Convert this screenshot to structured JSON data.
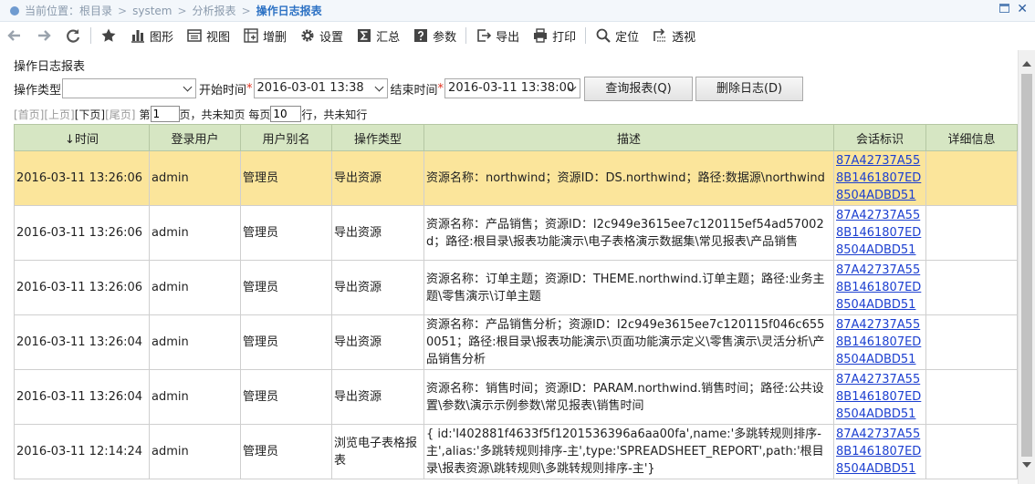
{
  "breadcrumb": {
    "prefix": "当前位置：",
    "items": [
      "根目录",
      "system",
      "分析报表"
    ],
    "current": "操作日志报表",
    "separator": ">"
  },
  "toolbar": {
    "buttons": [
      {
        "name": "back-button",
        "icon": "arrow-left-icon",
        "label": ""
      },
      {
        "name": "forward-button",
        "icon": "arrow-right-icon",
        "label": ""
      },
      {
        "name": "refresh-button",
        "icon": "refresh-icon",
        "label": ""
      },
      {
        "name": "favorite-button",
        "icon": "star-icon",
        "label": ""
      },
      {
        "name": "chart-button",
        "icon": "bar-chart-icon",
        "label": "图形"
      },
      {
        "name": "view-button",
        "icon": "view-icon",
        "label": "视图"
      },
      {
        "name": "add-column-button",
        "icon": "add-column-icon",
        "label": "增删"
      },
      {
        "name": "settings-button",
        "icon": "gear-icon",
        "label": "设置"
      },
      {
        "name": "summary-button",
        "icon": "sigma-icon",
        "label": "汇总"
      },
      {
        "name": "param-button",
        "icon": "question-icon",
        "label": "参数"
      },
      {
        "name": "export-button",
        "icon": "export-icon",
        "label": "导出"
      },
      {
        "name": "print-button",
        "icon": "printer-icon",
        "label": "打印"
      },
      {
        "name": "locate-button",
        "icon": "search-icon",
        "label": "定位"
      },
      {
        "name": "pivot-button",
        "icon": "pivot-icon",
        "label": "透视"
      }
    ]
  },
  "report_title": "操作日志报表",
  "filters": {
    "op_type_label": "操作类型",
    "op_type_value": "",
    "start_label": "开始时间",
    "start_value": "2016-03-01 13:38",
    "end_label": "结束时间",
    "end_value": "2016-03-11 13:38:00",
    "required_mark": "*",
    "query_button": "查询报表(Q)",
    "delete_button": "删除日志(D)"
  },
  "pager": {
    "first": "[首页]",
    "prev": "[上页]",
    "next": "[下页]",
    "last": "[尾页]",
    "page_prefix": "第",
    "page_value": "1",
    "page_suffix": "页，共未知页 每页",
    "size_value": "10",
    "size_suffix": "行，共未知行"
  },
  "table": {
    "columns": [
      "↓时间",
      "登录用户",
      "用户别名",
      "操作类型",
      "描述",
      "会话标识",
      "详细信息"
    ],
    "rows": [
      {
        "time": "2016-03-11 13:26:06",
        "user": "admin",
        "alias": "管理员",
        "op": "导出资源",
        "desc": "资源名称：northwind；资源ID：DS.northwind；路径:数据源\\northwind",
        "session": [
          "87A42737A55",
          "8B1461807ED",
          "8504ADBD51"
        ],
        "detail": ""
      },
      {
        "time": "2016-03-11 13:26:06",
        "user": "admin",
        "alias": "管理员",
        "op": "导出资源",
        "desc": "资源名称：产品销售；资源ID：I2c949e3615ee7c120115ef54ad57002d；路径:根目录\\报表功能演示\\电子表格演示数据集\\常见报表\\产品销售",
        "session": [
          "87A42737A55",
          "8B1461807ED",
          "8504ADBD51"
        ],
        "detail": ""
      },
      {
        "time": "2016-03-11 13:26:06",
        "user": "admin",
        "alias": "管理员",
        "op": "导出资源",
        "desc": "资源名称：订单主题；资源ID：THEME.northwind.订单主题；路径:业务主题\\零售演示\\订单主题",
        "session": [
          "87A42737A55",
          "8B1461807ED",
          "8504ADBD51"
        ],
        "detail": ""
      },
      {
        "time": "2016-03-11 13:26:04",
        "user": "admin",
        "alias": "管理员",
        "op": "导出资源",
        "desc": "资源名称：产品销售分析；资源ID：I2c949e3615ee7c120115f046c6550051；路径:根目录\\报表功能演示\\页面功能演示定义\\零售演示\\灵活分析\\产品销售分析",
        "session": [
          "87A42737A55",
          "8B1461807ED",
          "8504ADBD51"
        ],
        "detail": ""
      },
      {
        "time": "2016-03-11 13:26:04",
        "user": "admin",
        "alias": "管理员",
        "op": "导出资源",
        "desc": "资源名称：销售时间；资源ID：PARAM.northwind.销售时间；路径:公共设置\\参数\\演示示例参数\\常见报表\\销售时间",
        "session": [
          "87A42737A55",
          "8B1461807ED",
          "8504ADBD51"
        ],
        "detail": ""
      },
      {
        "time": "2016-03-11 12:14:24",
        "user": "admin",
        "alias": "管理员",
        "op": "浏览电子表格报表",
        "desc": "{ id:'I402881f4633f5f1201536396a6aa00fa',name:'多跳转规则排序-主',alias:'多跳转规则排序-主',type:'SPREADSHEET_REPORT',path:'根目录\\报表资源\\跳转规则\\多跳转规则排序-主'}",
        "session": [
          "87A42737A55",
          "8B1461807ED",
          "8504ADBD51"
        ],
        "detail": ""
      }
    ]
  },
  "colors": {
    "header_bg": "#d6e6c3",
    "highlight_row": "#fbe59b",
    "link": "#1c3fd0",
    "breadcrumb_current": "#2d72c4",
    "required": "#e0301e"
  }
}
